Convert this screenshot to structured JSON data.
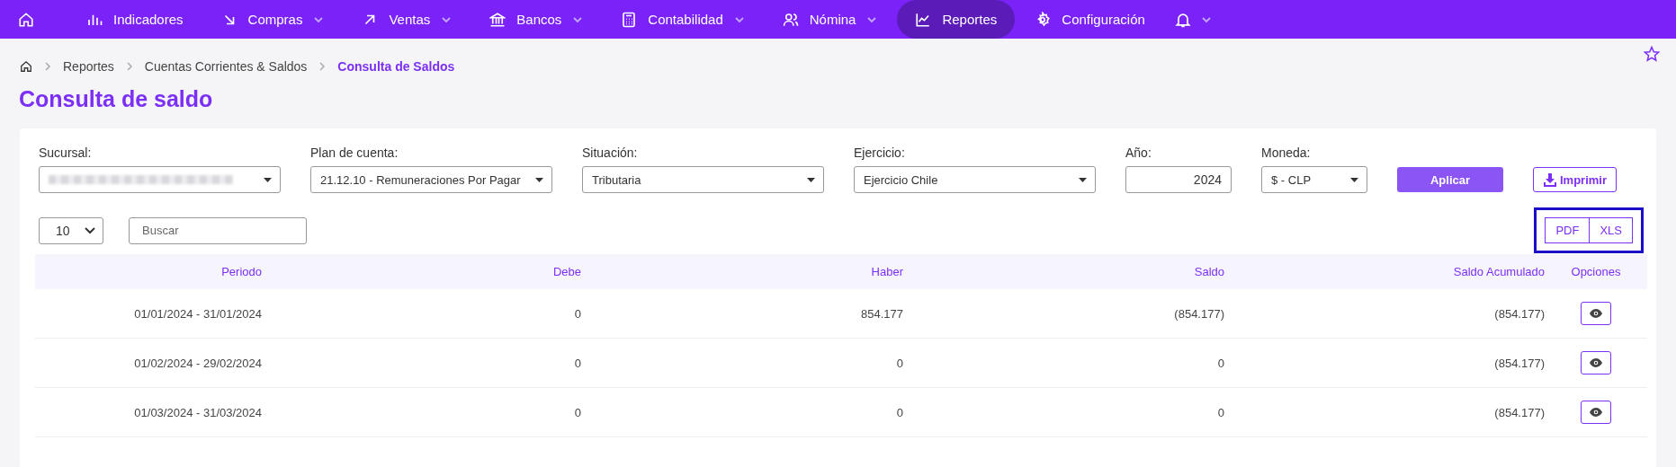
{
  "nav": {
    "items": [
      {
        "label": "Indicadores",
        "dropdown": false,
        "selected": false
      },
      {
        "label": "Compras",
        "dropdown": true,
        "selected": false
      },
      {
        "label": "Ventas",
        "dropdown": true,
        "selected": false
      },
      {
        "label": "Bancos",
        "dropdown": true,
        "selected": false
      },
      {
        "label": "Contabilidad",
        "dropdown": true,
        "selected": false
      },
      {
        "label": "Nómina",
        "dropdown": true,
        "selected": false
      },
      {
        "label": "Reportes",
        "dropdown": false,
        "selected": true
      },
      {
        "label": "Configuración",
        "dropdown": false,
        "selected": false
      }
    ]
  },
  "breadcrumb": [
    "Reportes",
    "Cuentas Corrientes & Saldos",
    "Consulta de Saldos"
  ],
  "title": "Consulta de saldo",
  "filters": [
    {
      "label": "Sucursal:",
      "kind": "select"
    },
    {
      "label": "Plan de cuenta:",
      "kind": "select",
      "value": "21.12.10 - Remuneraciones Por Pagar"
    },
    {
      "label": "Situación:",
      "kind": "select",
      "value": "Tributaria"
    },
    {
      "label": "Ejercicio:",
      "kind": "select",
      "value": "Ejercicio Chile"
    },
    {
      "label": "Año:",
      "kind": "input",
      "value": "2024"
    },
    {
      "label": "Moneda:",
      "kind": "select",
      "value": "$ - CLP"
    }
  ],
  "apply_button": "Aplicar",
  "print_button": "Imprimir",
  "page_size": "10",
  "search": {
    "placeholder": "Buscar"
  },
  "export": {
    "highlighted": true,
    "buttons": [
      "PDF",
      "XLS"
    ]
  },
  "table": {
    "columns": [
      "Periodo",
      "Debe",
      "Haber",
      "Saldo",
      "Saldo Acumulado",
      "Opciones"
    ],
    "rows": [
      [
        "01/01/2024 - 31/01/2024",
        "0",
        "854.177",
        "(854.177)",
        "(854.177)"
      ],
      [
        "01/02/2024 - 29/02/2024",
        "0",
        "0",
        "0",
        "(854.177)"
      ],
      [
        "01/03/2024 - 31/03/2024",
        "0",
        "0",
        "0",
        "(854.177)"
      ]
    ]
  }
}
